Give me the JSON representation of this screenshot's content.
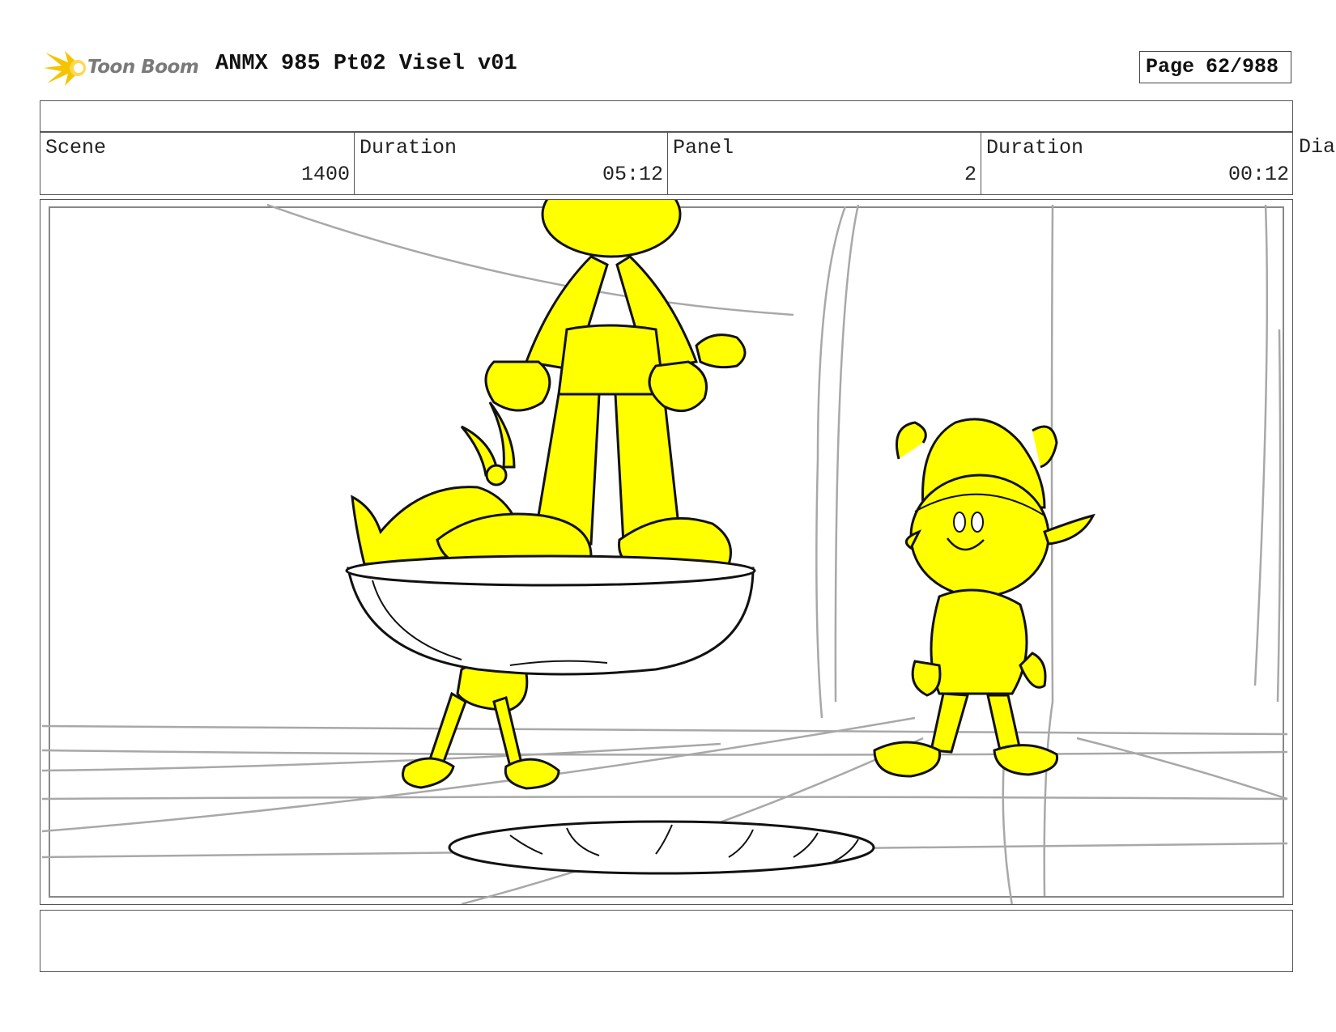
{
  "header": {
    "brand": "Toon Boom",
    "project_title": "ANMX 985 Pt02 Visel v01",
    "page_label": "Page",
    "page_number": "62/988"
  },
  "info": {
    "scene_label": "Scene",
    "scene_value": "1400",
    "scene_duration_label": "Duration",
    "scene_duration_value": "05:12",
    "panel_label": "Panel",
    "panel_value": "2",
    "panel_duration_label": "Duration",
    "panel_duration_value": "00:12",
    "dialogue_label_partial": "Dia"
  },
  "colors": {
    "character_fill": "#ffff00",
    "line": "#111111",
    "guide_line": "#a8a8a8",
    "logo_accent": "#f5c400"
  },
  "icons": {
    "logo": "toon-boom-star-logo"
  }
}
